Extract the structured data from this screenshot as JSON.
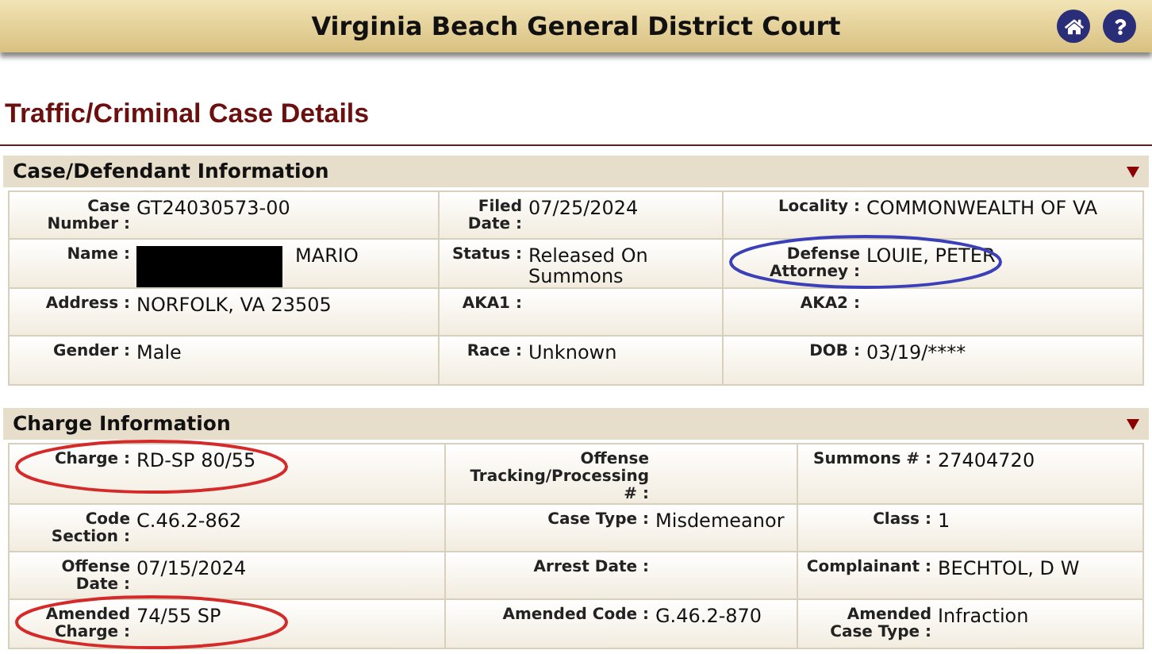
{
  "header": {
    "title": "Virginia Beach General District Court"
  },
  "page_title": "Traffic/Criminal Case Details",
  "sections": [
    {
      "title": "Case/Defendant Information",
      "expanded": true,
      "rows": [
        [
          {
            "label": "Case Number :",
            "value": "GT24030573-00"
          },
          {
            "label": "Filed Date :",
            "value": "07/25/2024"
          },
          {
            "label": "Locality :",
            "value": "COMMONWEALTH OF VA"
          }
        ],
        [
          {
            "label": "Name :",
            "value": "MARIO",
            "redacted": true
          },
          {
            "label": "Status :",
            "value": "Released On Summons"
          },
          {
            "label": "Defense Attorney :",
            "value": "LOUIE, PETER",
            "color": "#3b3fb8"
          }
        ],
        [
          {
            "label": "Address :",
            "value": "NORFOLK, VA 23505"
          },
          {
            "label": "AKA1 :"
          },
          {
            "label": "AKA2 :"
          }
        ],
        [
          {
            "label": "Gender :",
            "value": "Male"
          },
          {
            "label": "Race :",
            "value": "Unknown"
          },
          {
            "label": "DOB :",
            "value": "03/19/****"
          }
        ]
      ]
    },
    {
      "title": "Charge Information",
      "expanded": true,
      "rows": [
        [
          {
            "label": "Charge :",
            "value": "RD-SP 80/55",
            "color": "#d42a2a"
          },
          {
            "label": "Offense Tracking/Processing # :"
          },
          {
            "label": "Summons # :",
            "value": "27404720"
          }
        ],
        [
          {
            "label": "Code Section :",
            "value": "C.46.2-862"
          },
          {
            "label": "Case Type :",
            "value": "Misdemeanor"
          },
          {
            "label": "Class :",
            "value": "1"
          }
        ],
        [
          {
            "label": "Offense Date :",
            "value": "07/15/2024"
          },
          {
            "label": "Arrest Date :"
          },
          {
            "label": "Complainant :",
            "value": "BECHTOL, D W"
          }
        ],
        [
          {
            "label": "Amended Charge :",
            "value": "74/55 SP",
            "color": "#d42a2a"
          },
          {
            "label": "Amended Code :",
            "value": "G.46.2-870"
          },
          {
            "label": "Amended Case Type :",
            "value": "Infraction"
          }
        ]
      ]
    }
  ]
}
